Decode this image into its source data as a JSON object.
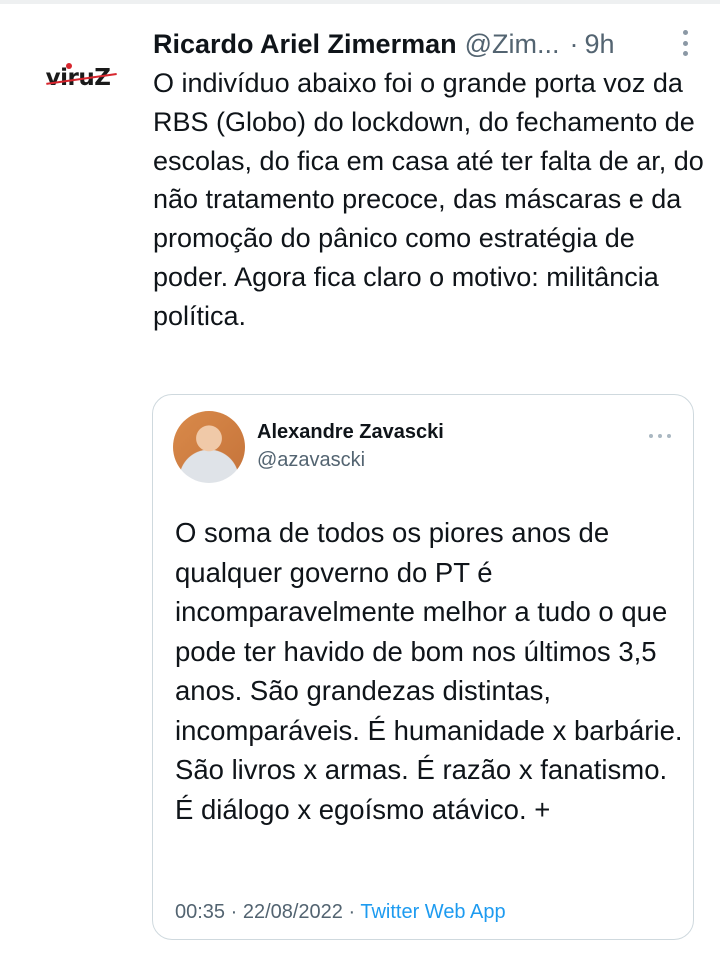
{
  "tweet": {
    "author_name": "Ricardo Ariel Zimerman",
    "author_handle": "@Zim...",
    "separator": "·",
    "time": "9h",
    "avatar_logo": "viruZ",
    "text": "O indivíduo abaixo foi o grande porta voz da RBS (Globo) do lockdown, do fechamento de escolas, do fica em casa até ter falta de ar, do não tratamento precoce, das máscaras e da promoção do pânico como estratégia de poder. Agora fica claro o motivo: militância política.",
    "more_icon": "more-vertical-icon"
  },
  "quoted_tweet": {
    "author_name": "Alexandre Zavascki",
    "author_handle": "@azavascki",
    "text": "O soma de todos os piores anos de qualquer governo do PT é incomparavelmente melhor a tudo o que pode ter havido de bom nos últimos 3,5 anos. São grandezas distintas, incomparáveis. É humanidade x barbárie. São livros x armas. É razão x fanatismo. É diálogo x egoísmo atávico. +",
    "timestamp": "00:35 · 22/08/2022 ·",
    "source": "Twitter Web App",
    "more_icon": "more-horizontal-icon"
  },
  "colors": {
    "text": "#0f1419",
    "secondary": "#536471",
    "link": "#1d9bf0",
    "border": "#cfd9de",
    "logo_accent": "#d7262e"
  }
}
